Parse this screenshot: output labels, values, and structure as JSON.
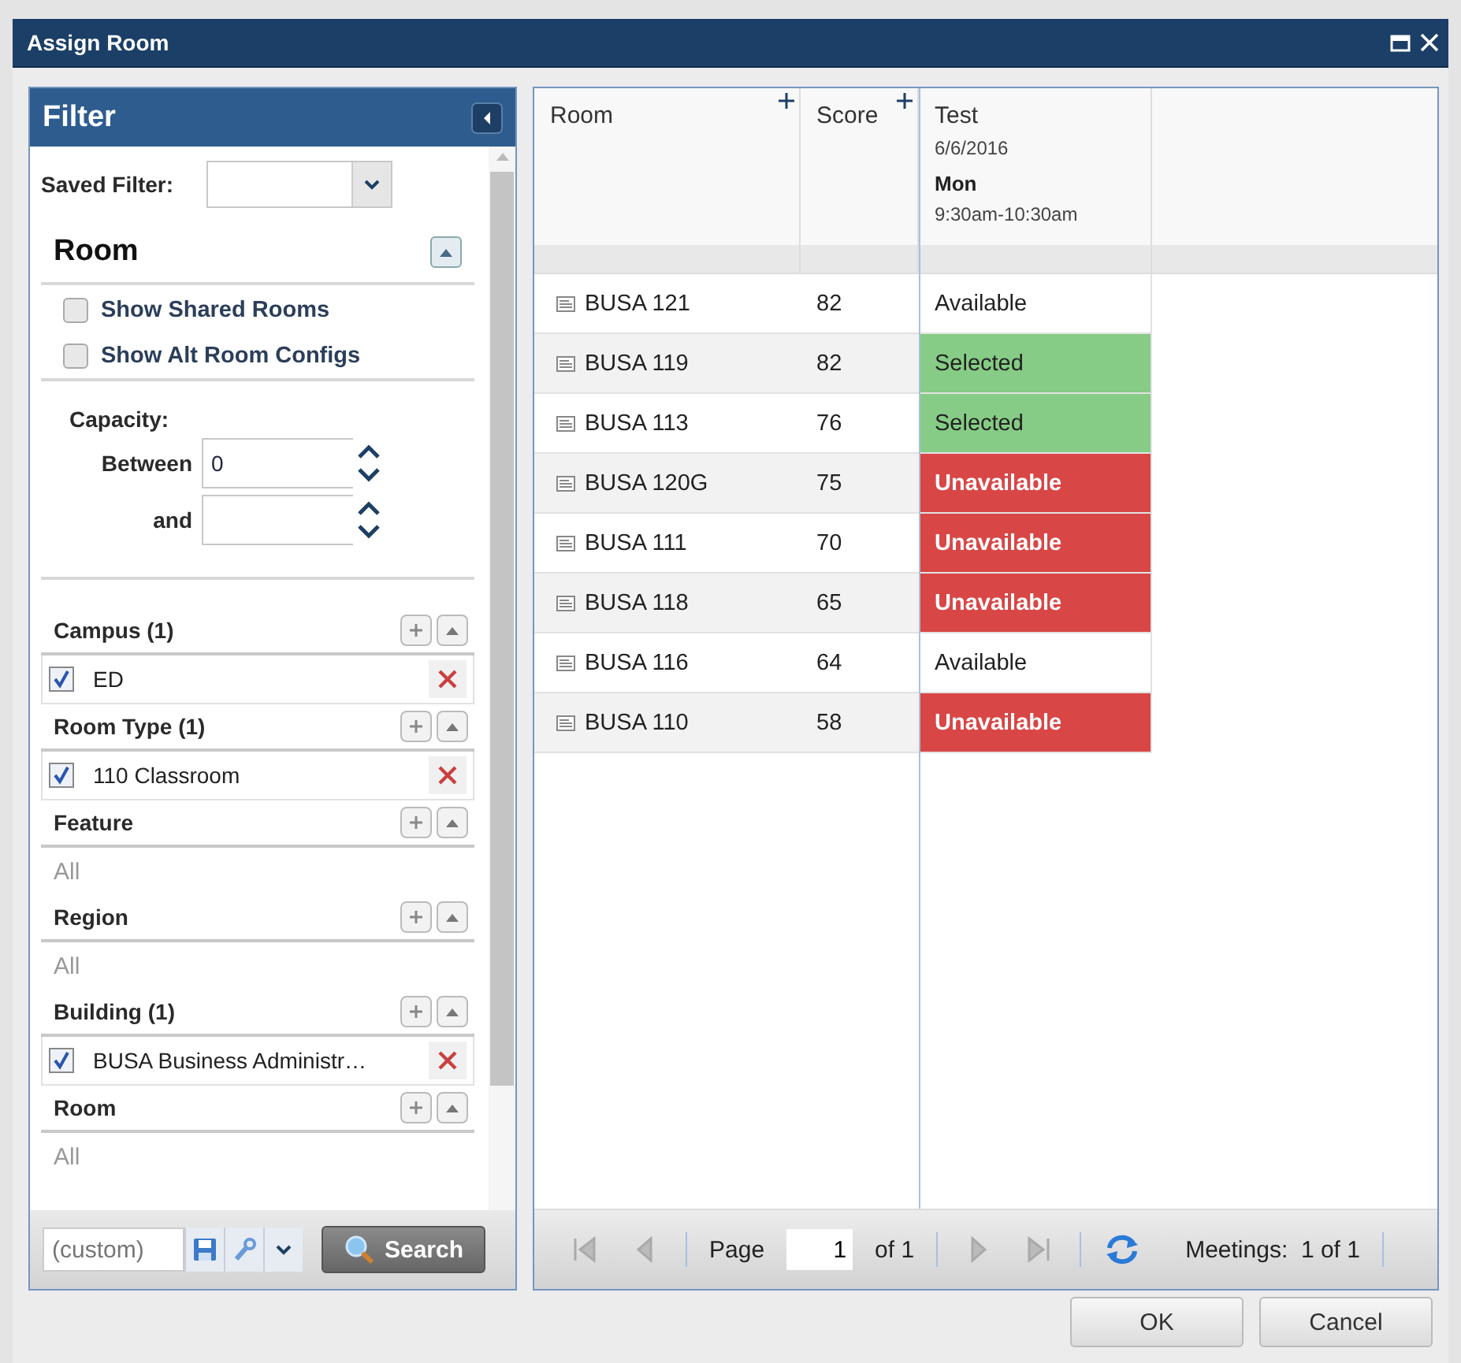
{
  "window": {
    "title": "Assign Room"
  },
  "filter": {
    "title": "Filter",
    "saved_filter_label": "Saved Filter:",
    "room_section": {
      "title": "Room",
      "options": [
        {
          "label": "Show Shared Rooms",
          "checked": false
        },
        {
          "label": "Show Alt Room Configs",
          "checked": false
        }
      ]
    },
    "capacity": {
      "label": "Capacity:",
      "between_label": "Between",
      "between_value": "0",
      "and_label": "and"
    },
    "facets": [
      {
        "title": "Campus (1)",
        "items": [
          {
            "label": "ED",
            "checked": true
          }
        ]
      },
      {
        "title": "Room Type (1)",
        "items": [
          {
            "label": "110 Classroom",
            "checked": true
          }
        ]
      },
      {
        "title": "Feature",
        "all_text": "All"
      },
      {
        "title": "Region",
        "all_text": "All"
      },
      {
        "title": "Building (1)",
        "items": [
          {
            "label": "BUSA Business Administr…",
            "checked": true
          }
        ]
      },
      {
        "title": "Room",
        "all_text": "All"
      }
    ],
    "custom_placeholder": "(custom)",
    "search_button": "Search"
  },
  "grid": {
    "columns": [
      "Room",
      "Score"
    ],
    "test_column": {
      "title": "Test",
      "date": "6/6/2016",
      "day": "Mon",
      "time": "9:30am-10:30am"
    },
    "rows": [
      {
        "room": "BUSA 121",
        "score": "82",
        "status": {
          "text": "Available",
          "kind": "available"
        }
      },
      {
        "room": "BUSA 119",
        "score": "82",
        "status": {
          "text": "Selected",
          "kind": "selected"
        }
      },
      {
        "room": "BUSA 113",
        "score": "76",
        "status": {
          "text": "Selected",
          "kind": "selected"
        }
      },
      {
        "room": "BUSA 120G",
        "score": "75",
        "status": {
          "text": "Unavailable",
          "kind": "unavailable"
        }
      },
      {
        "room": "BUSA 111",
        "score": "70",
        "status": {
          "text": "Unavailable",
          "kind": "unavailable"
        }
      },
      {
        "room": "BUSA 118",
        "score": "65",
        "status": {
          "text": "Unavailable",
          "kind": "unavailable"
        }
      },
      {
        "room": "BUSA 116",
        "score": "64",
        "status": {
          "text": "Available",
          "kind": "available"
        }
      },
      {
        "room": "BUSA 110",
        "score": "58",
        "status": {
          "text": "Unavailable",
          "kind": "unavailable"
        }
      }
    ],
    "pager": {
      "page_label": "Page",
      "page_value": "1",
      "of_text": "of 1",
      "meetings_text": "Meetings:  1 of 1"
    }
  },
  "buttons": [
    "OK",
    "Cancel"
  ]
}
